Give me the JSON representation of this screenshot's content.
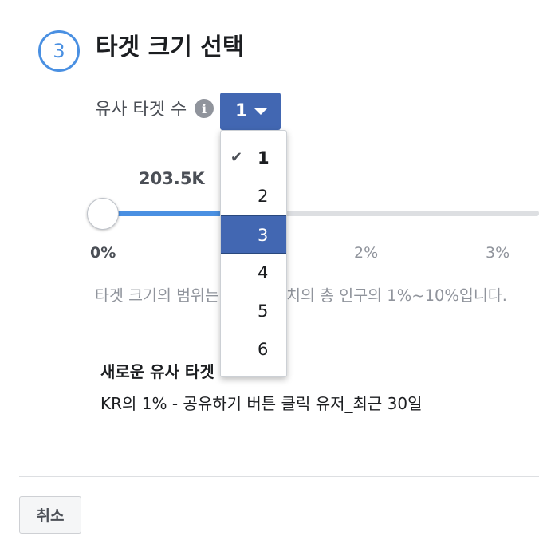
{
  "section": {
    "step_number": "3",
    "title": "타겟 크기 선택"
  },
  "count": {
    "label": "유사 타겟 수",
    "selected_value": "1",
    "options": [
      {
        "label": "1",
        "checked": true,
        "highlighted": false
      },
      {
        "label": "2",
        "checked": false,
        "highlighted": false
      },
      {
        "label": "3",
        "checked": false,
        "highlighted": true
      },
      {
        "label": "4",
        "checked": false,
        "highlighted": false
      },
      {
        "label": "5",
        "checked": false,
        "highlighted": false
      },
      {
        "label": "6",
        "checked": false,
        "highlighted": false
      }
    ]
  },
  "slider": {
    "reach_value": "203.5K",
    "handle_percent": 0,
    "ticks": [
      "0%",
      "2%",
      "3%"
    ]
  },
  "range_note": "타겟 크기의 범위는 선택된 위치의 총 인구의 1%~10%입니다.",
  "new_audience": {
    "title": "새로운 유사 타겟",
    "name": "KR의 1% - 공유하기 버튼 클릭 유저_최근 30일"
  },
  "footer": {
    "cancel_label": "취소"
  },
  "colors": {
    "accent": "#4a90e2",
    "button_blue": "#4267b2",
    "muted_text": "#90949c"
  },
  "icons": {
    "info": "info-icon",
    "caret": "chevron-down-icon",
    "check": "check-icon"
  }
}
